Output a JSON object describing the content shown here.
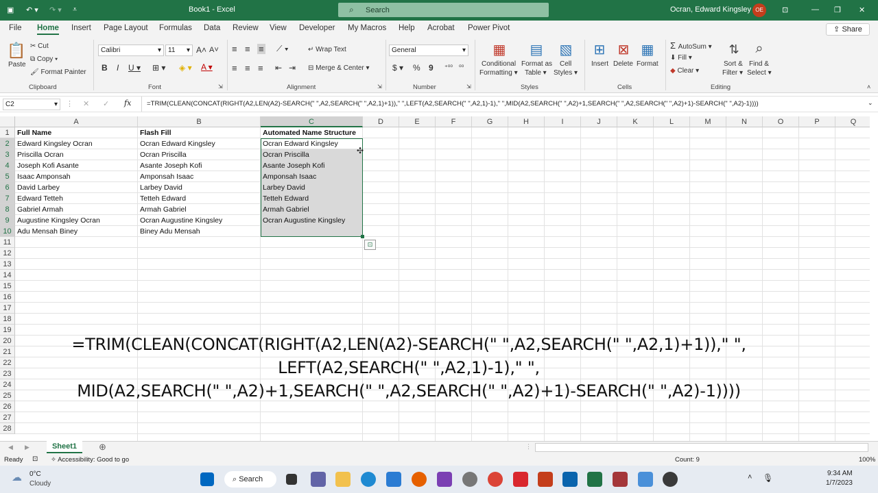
{
  "title": {
    "qat_save": "💾",
    "book": "Book1 - Excel",
    "search": "Search",
    "user": "Ocran, Edward Kingsley K",
    "avatar": "OE"
  },
  "menu": [
    "File",
    "Home",
    "Insert",
    "Page Layout",
    "Formulas",
    "Data",
    "Review",
    "View",
    "Developer",
    "My Macros",
    "Help",
    "Acrobat",
    "Power Pivot"
  ],
  "share": "Share",
  "ribbon": {
    "paste": "Paste",
    "cut": "Cut",
    "copy": "Copy",
    "format_painter": "Format Painter",
    "clipboard": "Clipboard",
    "font_name": "Calibri",
    "font_size": "11",
    "font": "Font",
    "wrap": "Wrap Text",
    "merge": "Merge & Center",
    "alignment": "Alignment",
    "numfmt": "General",
    "number": "Number",
    "cond": "Conditional",
    "cond2": "Formatting",
    "fat": "Format as",
    "fat2": "Table",
    "cs": "Cell",
    "cs2": "Styles",
    "styles": "Styles",
    "insert": "Insert",
    "delete": "Delete",
    "format": "Format",
    "cells": "Cells",
    "autosum": "AutoSum",
    "fill": "Fill",
    "clear": "Clear",
    "sort": "Sort &",
    "sort2": "Filter",
    "find": "Find &",
    "find2": "Select",
    "editing": "Editing"
  },
  "namebox": "C2",
  "formula": "=TRIM(CLEAN(CONCAT(RIGHT(A2,LEN(A2)-SEARCH(\" \",A2,SEARCH(\" \",A2,1)+1)),\" \",LEFT(A2,SEARCH(\" \",A2,1)-1),\" \",MID(A2,SEARCH(\" \",A2)+1,SEARCH(\" \",A2,SEARCH(\" \",A2)+1)-SEARCH(\" \",A2)-1))))",
  "columns": [
    "A",
    "B",
    "C",
    "D",
    "E",
    "F",
    "G",
    "H",
    "I",
    "J",
    "K",
    "L",
    "M",
    "N",
    "O",
    "P",
    "Q"
  ],
  "rows": [
    "1",
    "2",
    "3",
    "4",
    "5",
    "6",
    "7",
    "8",
    "9",
    "10",
    "11",
    "12",
    "13",
    "14",
    "15",
    "16",
    "17",
    "18",
    "19",
    "20",
    "21",
    "22",
    "23",
    "24",
    "25",
    "26",
    "27",
    "28"
  ],
  "headers": {
    "a": "Full Name",
    "b": "Flash Fill",
    "c": "Automated Name Structure"
  },
  "data": [
    [
      "Edward Kingsley Ocran",
      "Ocran Edward Kingsley",
      "Ocran Edward Kingsley"
    ],
    [
      "Priscilla  Ocran",
      "Ocran Priscilla",
      "Ocran Priscilla"
    ],
    [
      "Joseph Kofi Asante",
      "Asante Joseph Kofi",
      "Asante Joseph Kofi"
    ],
    [
      "Isaac  Amponsah",
      "Amponsah Isaac",
      "Amponsah Isaac"
    ],
    [
      "David  Larbey",
      "Larbey David",
      "Larbey David"
    ],
    [
      "Edward  Tetteh",
      "Tetteh Edward",
      "Tetteh Edward"
    ],
    [
      "Gabriel  Armah",
      "Armah Gabriel",
      "Armah Gabriel"
    ],
    [
      "Augustine Kingsley Ocran",
      "Ocran Augustine Kingsley",
      "Ocran Augustine Kingsley"
    ],
    [
      "Adu Mensah Biney",
      "Biney Adu Mensah",
      ""
    ]
  ],
  "overlay": [
    "=TRIM(CLEAN(CONCAT(RIGHT(A2,LEN(A2)-SEARCH(\" \",A2,SEARCH(\" \",A2,1)+1)),\" \",",
    "LEFT(A2,SEARCH(\" \",A2,1)-1),\" \",",
    "MID(A2,SEARCH(\" \",A2)+1,SEARCH(\" \",A2,SEARCH(\" \",A2)+1)-SEARCH(\" \",A2)-1))))"
  ],
  "sheet": "Sheet1",
  "status": {
    "ready": "Ready",
    "access": "Accessibility: Good to go",
    "count": "Count: 9",
    "zoom": "100%"
  },
  "taskbar": {
    "temp": "0°C",
    "weather": "Cloudy",
    "search": "Search",
    "time": "9:34 AM",
    "date": "1/7/2023"
  },
  "colors": {
    "excel_green": "#217346",
    "selection": "#d9d9d9"
  }
}
